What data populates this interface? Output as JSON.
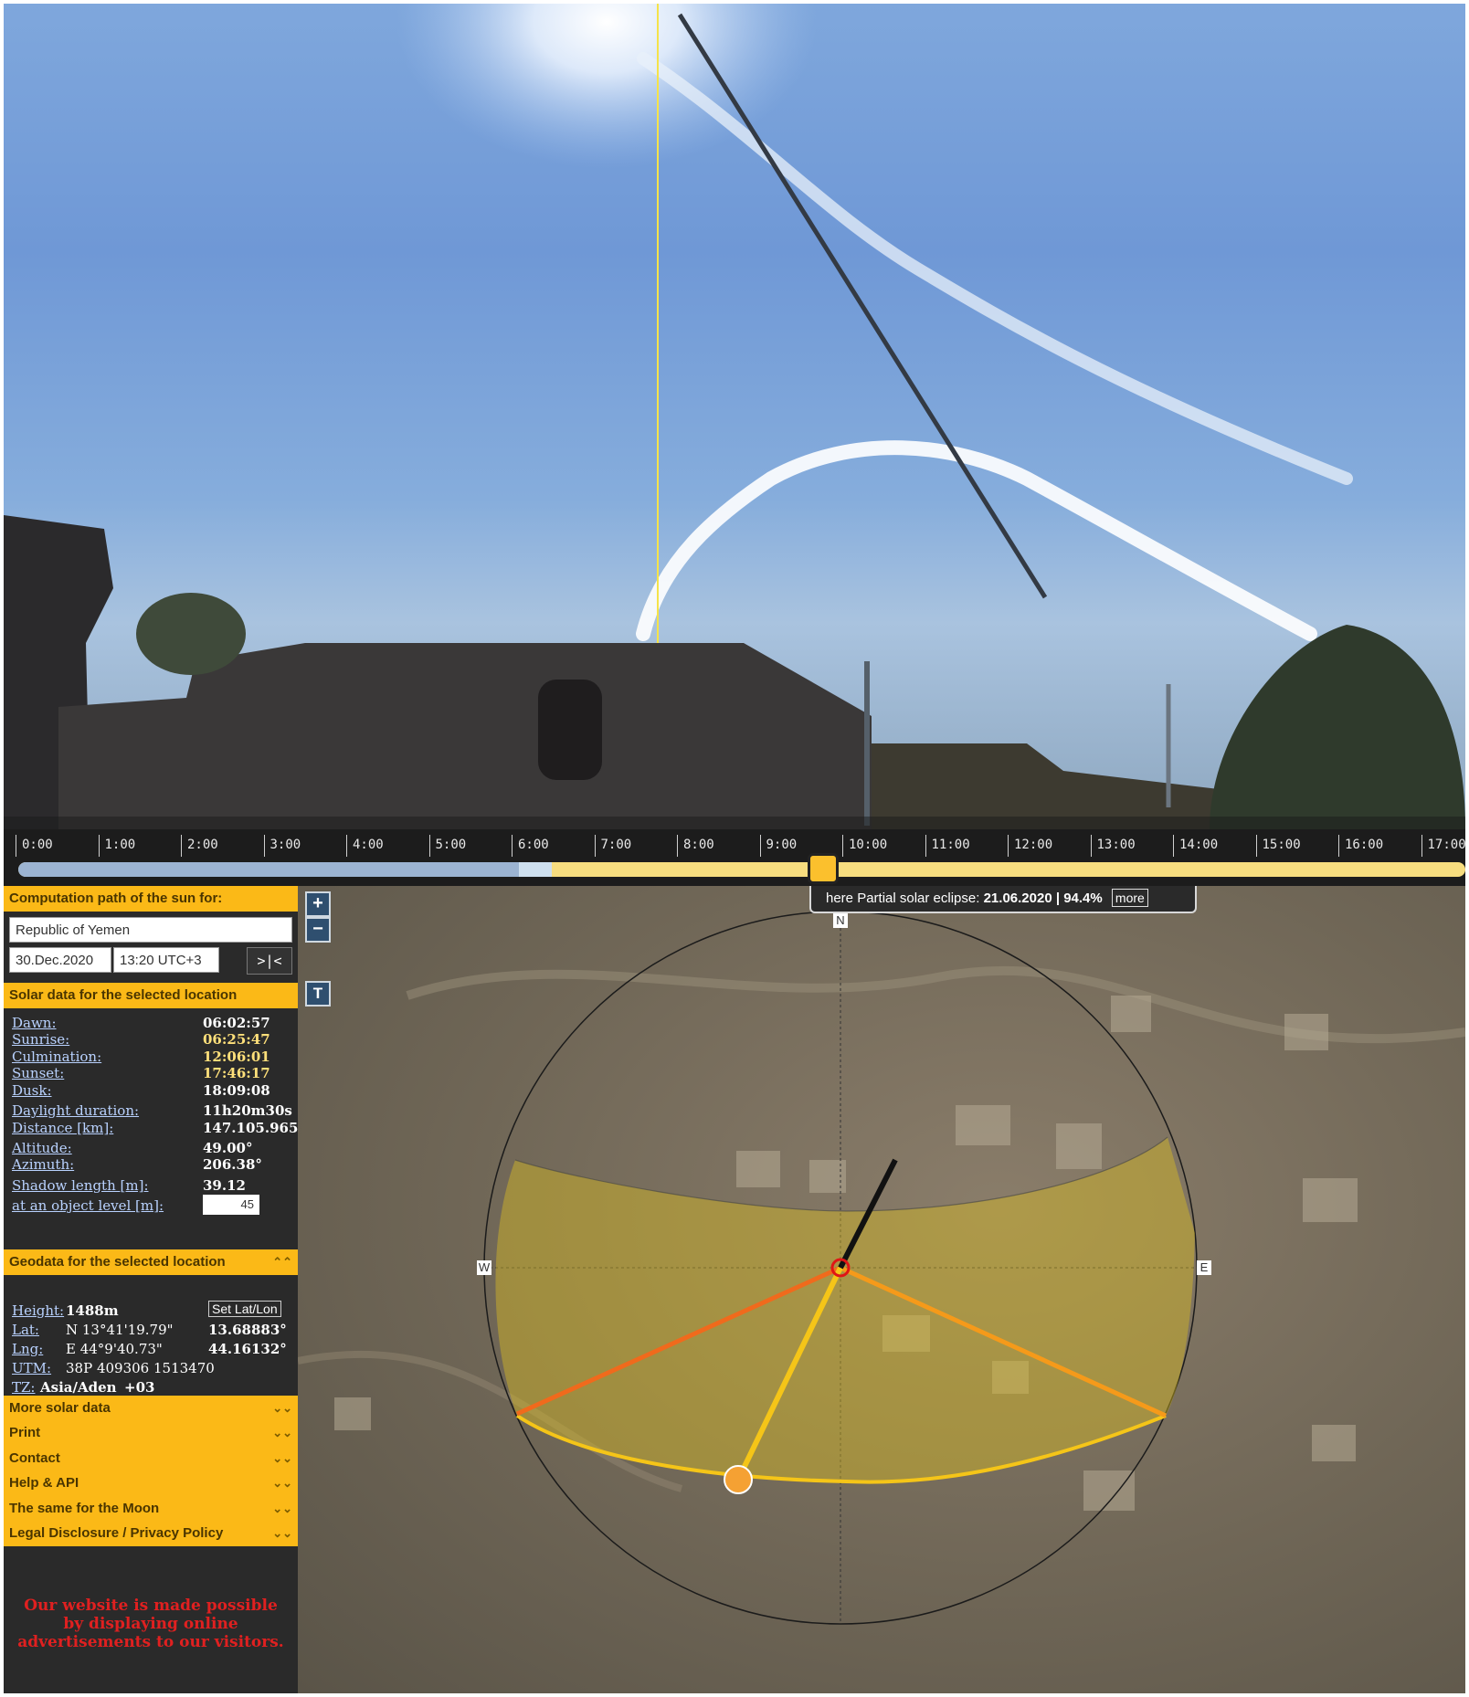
{
  "timeline": {
    "hours": [
      "0:00",
      "1:00",
      "2:00",
      "3:00",
      "4:00",
      "5:00",
      "6:00",
      "7:00",
      "8:00",
      "9:00",
      "10:00",
      "11:00",
      "12:00",
      "13:00",
      "14:00",
      "15:00",
      "16:00",
      "17:00"
    ],
    "current_time_fraction": 0.556
  },
  "sidebar": {
    "path_header": "Computation path of the sun for:",
    "location_value": "Republic of Yemen",
    "date_value": "30.Dec.2020",
    "time_value": "13:20 UTC+3",
    "now_button": ">|<",
    "solar_header": "Solar data for the selected location",
    "solar_rows": [
      {
        "label": "Dawn:",
        "value": "06:02:57"
      },
      {
        "label": "Sunrise:",
        "value": "06:25:47"
      },
      {
        "label": "Culmination:",
        "value": "12:06:01"
      },
      {
        "label": "Sunset:",
        "value": "17:46:17"
      },
      {
        "label": "Dusk:",
        "value": "18:09:08"
      },
      {
        "label": "Daylight duration:",
        "value": "11h20m30s"
      },
      {
        "label": "Distance [km]:",
        "value": "147.105.965"
      },
      {
        "label": "Altitude:",
        "value": "49.00°"
      },
      {
        "label": "Azimuth:",
        "value": "206.38°"
      },
      {
        "label": "Shadow length [m]:",
        "value": "39.12"
      },
      {
        "label": "at an object level [m]:",
        "value": "45"
      }
    ],
    "geo_header": "Geodata for the selected location",
    "geo": {
      "height_label": "Height:",
      "height_value": "1488m",
      "set_latlon_button": "Set Lat/Lon",
      "lat_label": "Lat:",
      "lat_dms": "N 13°41'19.79\"",
      "lat_dec": "13.68883°",
      "lng_label": "Lng:",
      "lng_dms": "E 44°9'40.73\"",
      "lng_dec": "44.16132°",
      "utm_label": "UTM:",
      "utm_value": "38P 409306 1513470",
      "tz_label": "TZ:",
      "tz_value": "Asia/Aden",
      "tz_offset": "+03"
    },
    "menu": [
      "More solar data",
      "Print",
      "Contact",
      "Help & API",
      "The same for the Moon",
      "Legal Disclosure / Privacy Policy"
    ],
    "ad_text": [
      "Our website is made possible",
      "by displaying online",
      "advertisements to our visitors."
    ]
  },
  "map": {
    "zoom_in": "+",
    "zoom_out": "−",
    "layer_button": "T",
    "eclipse_prefix": "here Partial solar eclipse:",
    "eclipse_value": "21.06.2020 | 94.4%",
    "eclipse_more": "more",
    "compass": {
      "north": "N",
      "west": "W",
      "east": "E"
    },
    "colors": {
      "sunrise_line": "#f06a1c",
      "sunset_line": "#f59a1a",
      "current_sun_line": "#f5c518",
      "shadow_line": "#111111",
      "daylight_area": "#e0c020"
    }
  }
}
